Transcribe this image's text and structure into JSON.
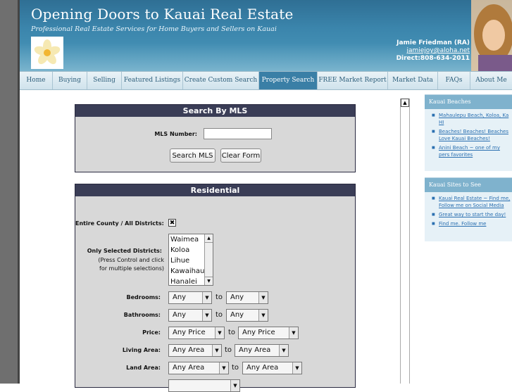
{
  "header": {
    "title": "Opening Doors to Kauai Real Estate",
    "tagline": "Professional Real Estate Services for Home Buyers and Sellers on Kauai",
    "agent_name": "Jamie Friedman (RA)",
    "agent_email": "jamiejoy@aloha.net",
    "agent_phone": "Direct:808-634-2011"
  },
  "nav": {
    "items": [
      "Home",
      "Buying",
      "Selling",
      "Featured Listings",
      "Create Custom Search",
      "Property Search",
      "FREE Market Report",
      "Market Data",
      "FAQs",
      "About Me"
    ],
    "active": "Property Search"
  },
  "mls_panel": {
    "title": "Search By MLS",
    "mls_label": "MLS Number:",
    "mls_value": "",
    "search_button": "Search MLS",
    "clear_button": "Clear Form"
  },
  "residential": {
    "title": "Residential",
    "entire_county_label": "Entire County / All Districts:",
    "entire_county_checked": "✖",
    "districts_label": "Only Selected Districts:",
    "districts_note_1": "(Press Control and click",
    "districts_note_2": "for multiple selections)",
    "districts": [
      "Waimea",
      "Koloa",
      "Lihue",
      "Kawaihau",
      "Hanalei"
    ],
    "bedrooms_label": "Bedrooms:",
    "bedrooms_min": "Any",
    "bedrooms_max": "Any",
    "bathrooms_label": "Bathrooms:",
    "bathrooms_min": "Any",
    "bathrooms_max": "Any",
    "price_label": "Price:",
    "price_min": "Any Price",
    "price_max": "Any Price",
    "living_area_label": "Living Area:",
    "living_min": "Any Area",
    "living_max": "Any Area",
    "land_area_label": "Land Area:",
    "land_min": "Any Area",
    "land_max": "Any Area",
    "to_word": "to"
  },
  "sidebar": {
    "beaches": {
      "title": "Kauai Beaches",
      "links": [
        "Mahaulepu Beach, Koloa, Ka HI",
        "Beaches! Beaches! Beaches Love Kauai Beaches!",
        "Anini Beach ~ one of my pers favorites"
      ]
    },
    "sites": {
      "title": "Kauai Sites to See",
      "links": [
        "Kauai Real Estate ~ Find me, Follow me on Social Media",
        "Great way to start the day!",
        "Find me. Follow me"
      ]
    }
  }
}
